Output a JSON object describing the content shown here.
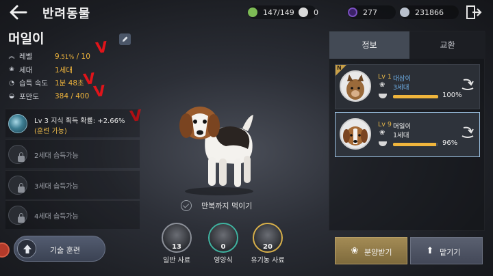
{
  "header": {
    "title": "반려동물",
    "resources": [
      {
        "icon": "badge-icon",
        "value": "147/149",
        "color": "#7dbb55"
      },
      {
        "icon": "pearl-icon",
        "value": "0",
        "color": "#d9d9d9"
      },
      {
        "icon": "purple-orb-icon",
        "value": "277",
        "color": "#7a4fc0"
      },
      {
        "icon": "silver-coin-icon",
        "value": "231866",
        "color": "#b8c0cc"
      }
    ]
  },
  "pet": {
    "name": "머일이",
    "stats": [
      {
        "icon": "chevrons-up-icon",
        "label": "레벨",
        "value_main": "9",
        "value_small": ".51%",
        "value_tail": " / 10"
      },
      {
        "icon": "paw-icon",
        "label": "세대",
        "value_main": "1세대",
        "value_small": "",
        "value_tail": ""
      },
      {
        "icon": "timer-icon",
        "label": "습득 속도",
        "value_main": "1분 48초",
        "value_small": "",
        "value_tail": ""
      },
      {
        "icon": "bowl-icon",
        "label": "포만도",
        "value_main": "384 / 400",
        "value_small": "",
        "value_tail": ""
      }
    ]
  },
  "skills": [
    {
      "line1": "Lv 3 지식 획득 확률: +2.66%",
      "line2": "(훈련 가능)",
      "locked": false
    },
    {
      "text": "2세대 습득가능",
      "locked": true
    },
    {
      "text": "3세대 습득가능",
      "locked": true
    },
    {
      "text": "4세대 습득가능",
      "locked": true
    }
  ],
  "train_button": {
    "label": "기술 훈련"
  },
  "feed": {
    "repeat_label": "만복까지 먹이기",
    "items": [
      {
        "name": "일반 사료",
        "count": "13",
        "rim": "#8c9099"
      },
      {
        "name": "영양식",
        "count": "0",
        "rim": "#3fb3a0"
      },
      {
        "name": "유기농 사료",
        "count": "20",
        "rim": "#d8b04a"
      }
    ]
  },
  "right_panel": {
    "tabs": [
      "정보",
      "교환"
    ],
    "pets": [
      {
        "badge": "N",
        "lv": "Lv 1",
        "name": "대삼이",
        "gen": "3세대",
        "fullness": 100,
        "pct_label": "100%",
        "name_color": "#6fb0e8",
        "selected": false
      },
      {
        "badge": "",
        "lv": "Lv 9",
        "name": "머일이",
        "gen": "1세대",
        "fullness": 96,
        "pct_label": "96%",
        "name_color": "#f0f0f0",
        "selected": true
      }
    ],
    "adopt_label": "분양받기",
    "entrust_label": "맡기기"
  }
}
